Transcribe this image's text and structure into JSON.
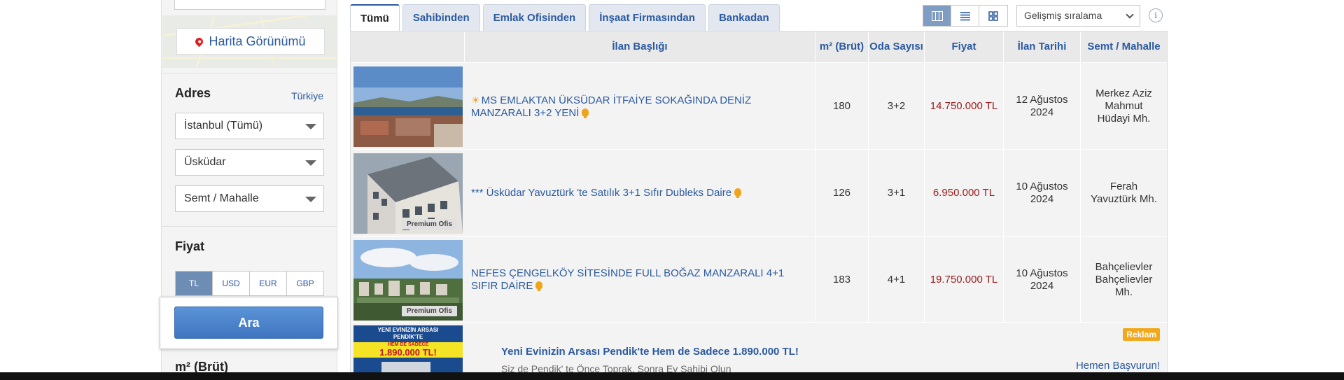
{
  "sidebar": {
    "map_button": "Harita Görünümü",
    "address": {
      "title": "Adres",
      "country_link": "Türkiye",
      "city": "İstanbul (Tümü)",
      "district": "Üsküdar",
      "neighborhood": "Semt / Mahalle"
    },
    "price": {
      "title": "Fiyat",
      "currencies": [
        "TL",
        "USD",
        "EUR",
        "GBP"
      ],
      "selected_currency": "TL"
    },
    "search_button": "Ara",
    "area_title": "m² (Brüt)"
  },
  "tabs": [
    {
      "label": "Tümü",
      "active": true
    },
    {
      "label": "Sahibinden",
      "active": false
    },
    {
      "label": "Emlak Ofisinden",
      "active": false
    },
    {
      "label": "İnşaat Firmasından",
      "active": false
    },
    {
      "label": "Bankadan",
      "active": false
    }
  ],
  "view_modes": [
    "table-view-icon",
    "list-view-icon",
    "grid-view-icon"
  ],
  "sort": {
    "selected": "Gelişmiş sıralama"
  },
  "table": {
    "headers": [
      "İlan Başlığı",
      "m² (Brüt)",
      "Oda Sayısı",
      "Fiyat",
      "İlan Tarihi",
      "Semt / Mahalle"
    ],
    "rows": [
      {
        "title": "MS EMLAKTAN ÜKSÜDAR İTFAİYE SOKAĞINDA DENİZ MANZARALI 3+2 YENİ",
        "area": "180",
        "rooms": "3+2",
        "price": "14.750.000 TL",
        "date_line1": "12 Ağustos",
        "date_line2": "2024",
        "location": "Merkez Aziz Mahmut Hüdayi Mh.",
        "badge": ""
      },
      {
        "title": "*** Üsküdar Yavuztürk 'te Satılık 3+1 Sıfır Dubleks Daire",
        "area": "126",
        "rooms": "3+1",
        "price": "6.950.000 TL",
        "date_line1": "10 Ağustos",
        "date_line2": "2024",
        "location": "Ferah Yavuztürk Mh.",
        "badge": "Premium Ofis"
      },
      {
        "title": "NEFES ÇENGELKÖY SİTESİNDE FULL BOĞAZ MANZARALI 4+1 SIFIR DAİRE",
        "area": "183",
        "rooms": "4+1",
        "price": "19.750.000 TL",
        "date_line1": "10 Ağustos",
        "date_line2": "2024",
        "location": "Bahçelievler Bahçelievler Mh.",
        "badge": "Premium Ofis"
      }
    ]
  },
  "ad": {
    "thumb_line1": "YENİ EVİNİZİN ARSASI",
    "thumb_line2": "PENDİK'TE",
    "thumb_line3": "HEM DE SADECE",
    "thumb_price": "1.890.000 TL!",
    "title": "Yeni Evinizin Arsası Pendik'te Hem de Sadece 1.890.000 TL!",
    "description": "Siz de Pendik' te Önce Toprak, Sonra Ev Sahibi Olun",
    "badge": "Reklam",
    "cta": "Hemen Başvurun!"
  }
}
